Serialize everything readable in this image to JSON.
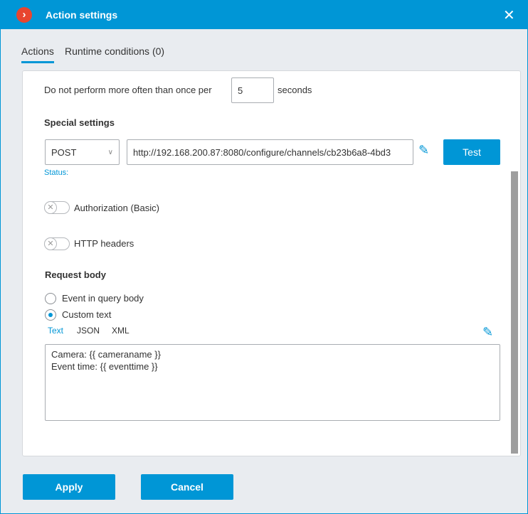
{
  "window": {
    "title": "Action settings",
    "close_icon": "close-icon",
    "logo_icon": "chevron-right-logo"
  },
  "tabs": [
    {
      "label": "Actions",
      "active": true
    },
    {
      "label": "Runtime conditions (0)",
      "active": false
    }
  ],
  "rate": {
    "prefix": "Do not perform more often than once per",
    "value": "5",
    "suffix": "seconds"
  },
  "special": {
    "heading": "Special settings",
    "method": "POST",
    "url": "http://192.168.200.87:8080/configure/channels/cb23b6a8-4bd3",
    "test_label": "Test",
    "status_label": "Status:"
  },
  "toggles": [
    {
      "label": "Authorization (Basic)",
      "on": false
    },
    {
      "label": "HTTP headers",
      "on": false
    }
  ],
  "request_body": {
    "heading": "Request body",
    "options": [
      {
        "label": "Event in query body",
        "selected": false
      },
      {
        "label": "Custom text",
        "selected": true
      }
    ],
    "formats": [
      {
        "label": "Text",
        "active": true
      },
      {
        "label": "JSON",
        "active": false
      },
      {
        "label": "XML",
        "active": false
      }
    ],
    "body_lines": [
      "Camera: {{ cameraname }}",
      "Event time: {{ eventtime }}"
    ]
  },
  "footer": {
    "apply_label": "Apply",
    "cancel_label": "Cancel"
  },
  "colors": {
    "accent": "#0096d6",
    "logo": "#e8452f"
  }
}
